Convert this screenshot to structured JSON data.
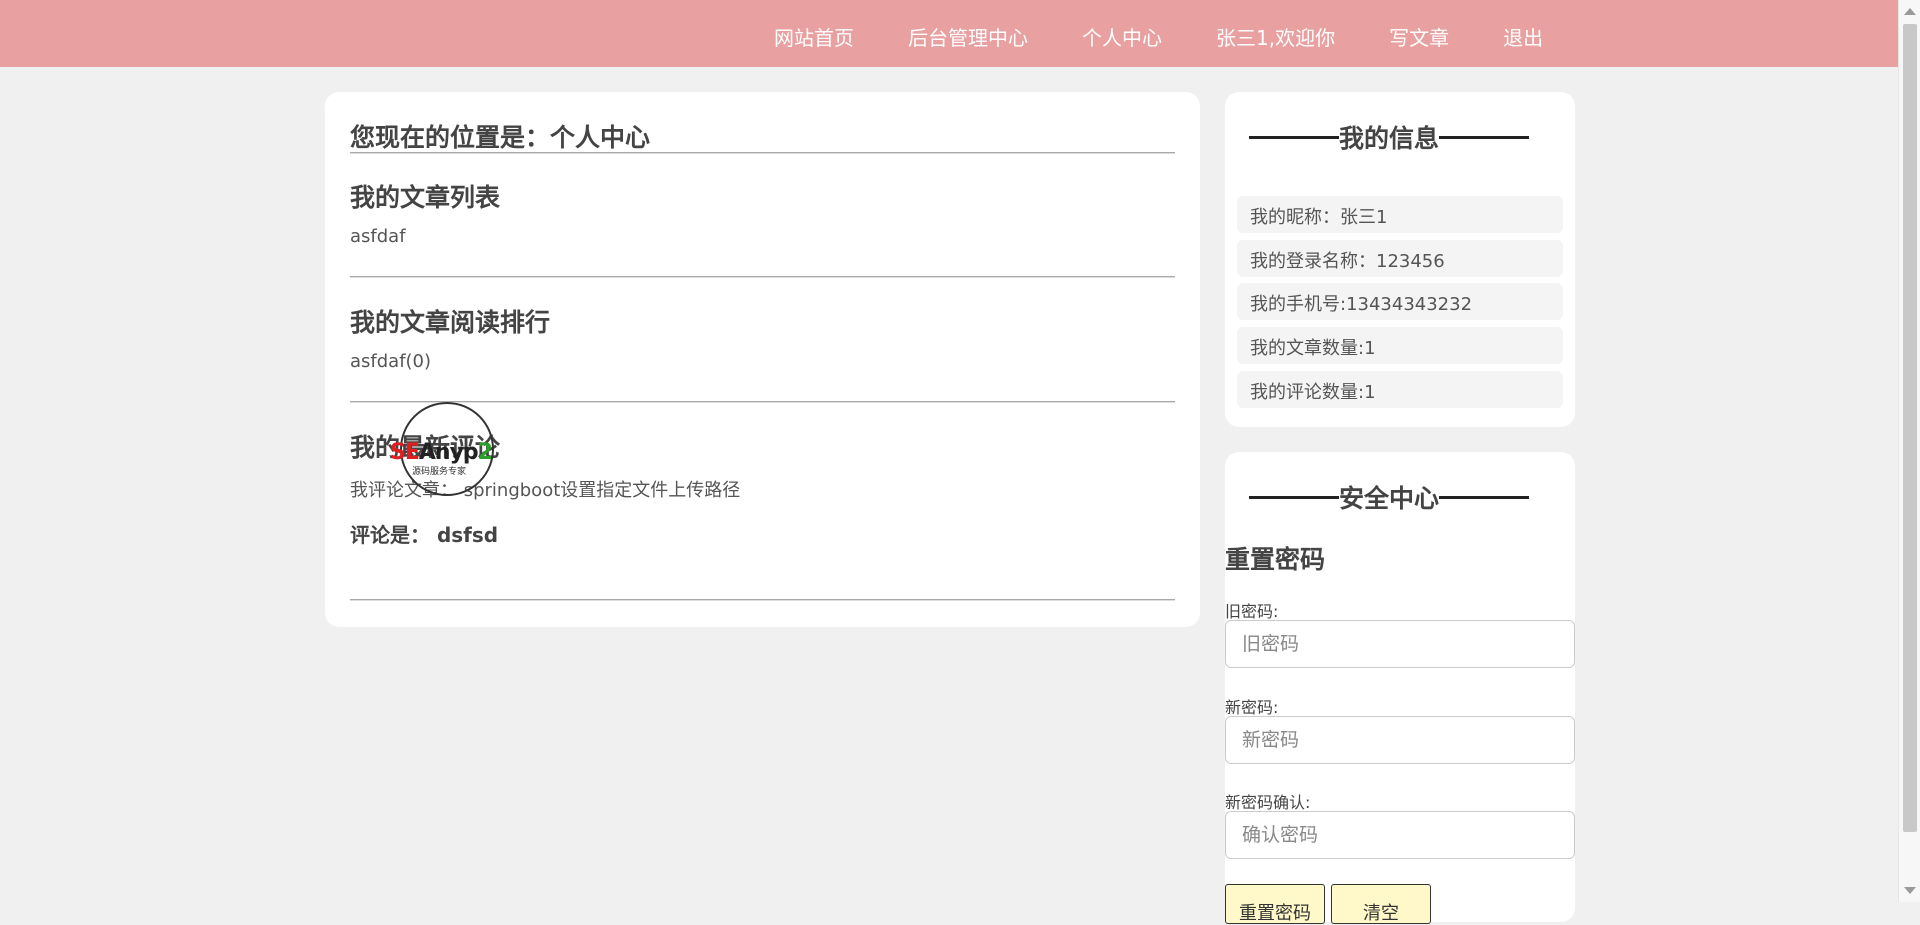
{
  "nav": {
    "items": [
      {
        "label": "网站首页"
      },
      {
        "label": "后台管理中心"
      },
      {
        "label": "个人中心"
      },
      {
        "label": "张三1,欢迎你"
      },
      {
        "label": "写文章"
      },
      {
        "label": "退出"
      }
    ]
  },
  "main": {
    "location": "您现在的位置是：个人中心",
    "articles": {
      "title": "我的文章列表",
      "items": [
        "asfdaf"
      ]
    },
    "ranking": {
      "title": "我的文章阅读排行",
      "items": [
        "asfdaf(0)"
      ]
    },
    "comments": {
      "title": "我的最新评论",
      "article_line": "我评论文章：  springboot设置指定文件上传路径",
      "comment_line": "评论是：   dsfsd"
    },
    "stamp": {
      "logo_text": "SEAnyp2",
      "sub_text": "源码服务专家"
    }
  },
  "profile": {
    "title": "我的信息",
    "items": [
      "我的昵称：张三1",
      "我的登录名称：123456",
      "我的手机号:13434343232",
      "我的文章数量:1",
      "我的评论数量:1"
    ]
  },
  "security": {
    "title": "安全中心",
    "reset_heading": "重置密码",
    "old_label": "旧密码:",
    "old_placeholder": "旧密码",
    "new_label": "新密码:",
    "new_placeholder": "新密码",
    "confirm_label": "新密码确认:",
    "confirm_placeholder": "确认密码",
    "submit_label": "重置密码",
    "clear_label": "清空"
  },
  "colors": {
    "topbar": "#e8a0a0",
    "button_bg": "#fff8c8",
    "page_bg": "#f0f0f0"
  }
}
